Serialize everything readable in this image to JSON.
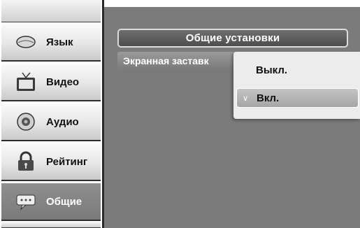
{
  "sidebar": {
    "items": [
      {
        "label": "Язык",
        "icon": "speech-bubble-icon"
      },
      {
        "label": "Видео",
        "icon": "tv-icon"
      },
      {
        "label": "Аудио",
        "icon": "speaker-icon"
      },
      {
        "label": "Рейтинг",
        "icon": "lock-icon"
      },
      {
        "label": "Общие",
        "icon": "chat-bubble-icon",
        "active": true
      }
    ]
  },
  "main": {
    "header_title": "Общие установки",
    "setting_label": "Экранная заставк",
    "options": [
      {
        "label": "Выкл.",
        "selected": false
      },
      {
        "label": "Вкл.",
        "selected": true,
        "mark": "∨"
      }
    ]
  },
  "colors": {
    "panel": "#7b7b7b",
    "sidebar_active": "#7a7a7a",
    "popup": "#ececec"
  }
}
